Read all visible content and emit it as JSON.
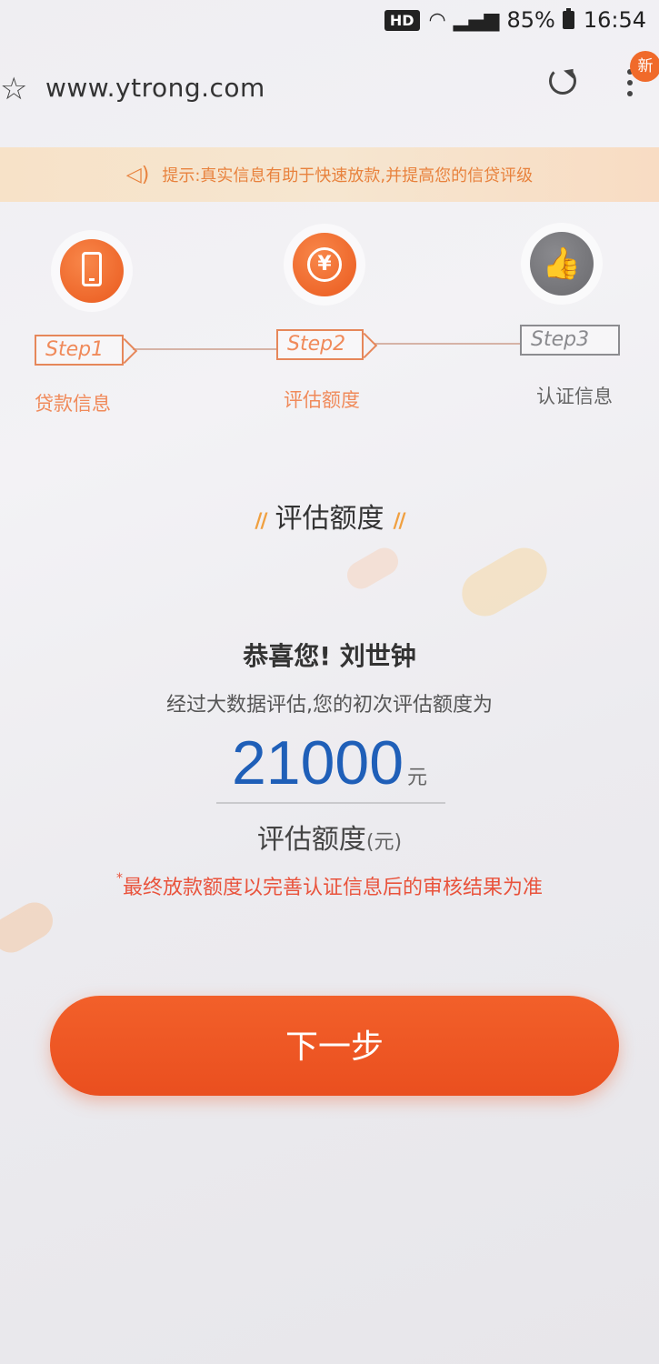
{
  "status_bar": {
    "hd": "HD",
    "battery": "85%",
    "time": "16:54"
  },
  "browser": {
    "url": "www.ytrong.com",
    "new_badge": "新"
  },
  "tip": {
    "text": "提示:真实信息有助于快速放款,并提高您的信贷评级"
  },
  "steps": [
    {
      "tag": "Step1",
      "label": "贷款信息",
      "icon": "phone-icon"
    },
    {
      "tag": "Step2",
      "label": "评估额度",
      "icon": "yen-icon"
    },
    {
      "tag": "Step3",
      "label": "认证信息",
      "icon": "thumbs-up-icon"
    }
  ],
  "section": {
    "deco": "//",
    "title": "评估额度"
  },
  "result": {
    "congrats": "恭喜您! 刘世钟",
    "description": "经过大数据评估,您的初次评估额度为",
    "amount": "21000",
    "unit": "元",
    "amount_label": "评估额度",
    "amount_label_unit": "(元)",
    "note_star": "*",
    "note": "最终放款额度以完善认证信息后的审核结果为准"
  },
  "actions": {
    "next_label": "下一步"
  },
  "colors": {
    "accent": "#ea5a1e",
    "amount": "#1f5fb8",
    "note": "#e9533c"
  }
}
